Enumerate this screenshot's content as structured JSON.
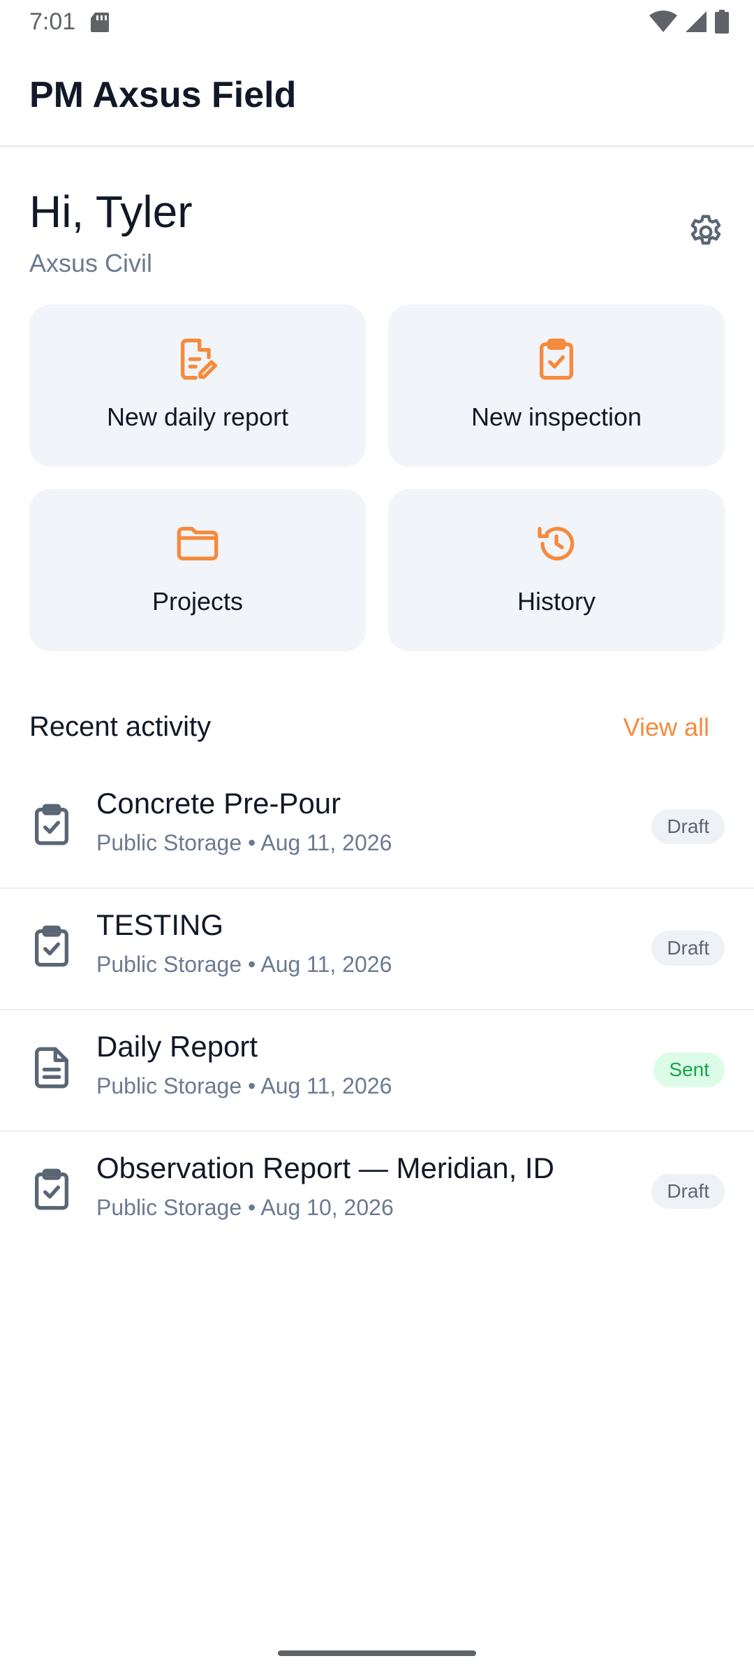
{
  "status_bar": {
    "time": "7:01"
  },
  "app_bar": {
    "title": "PM Axsus Field"
  },
  "greeting": {
    "text": "Hi, Tyler",
    "company": "Axsus Civil"
  },
  "actions": [
    {
      "label": "New daily report",
      "icon": "document-edit-icon"
    },
    {
      "label": "New inspection",
      "icon": "clipboard-check-icon"
    },
    {
      "label": "Projects",
      "icon": "folder-icon"
    },
    {
      "label": "History",
      "icon": "history-icon"
    }
  ],
  "recent": {
    "title": "Recent activity",
    "view_all": "View all",
    "items": [
      {
        "title": "Concrete Pre-Pour",
        "subtitle": "Public Storage • Aug 11, 2026",
        "status": "Draft",
        "icon": "clipboard-check-icon"
      },
      {
        "title": "TESTING",
        "subtitle": "Public Storage • Aug 11, 2026",
        "status": "Draft",
        "icon": "clipboard-check-icon"
      },
      {
        "title": "Daily Report",
        "subtitle": "Public Storage • Aug 11, 2026",
        "status": "Sent",
        "icon": "document-icon"
      },
      {
        "title": "Observation Report — Meridian, ID",
        "subtitle": "Public Storage • Aug 10, 2026",
        "status": "Draft",
        "icon": "clipboard-check-icon"
      }
    ]
  },
  "colors": {
    "accent": "#f58a3c",
    "tile_bg": "#f1f4f8",
    "muted_text": "#6b7a90",
    "sent_bg": "#dcfce7",
    "sent_text": "#16a34a"
  }
}
